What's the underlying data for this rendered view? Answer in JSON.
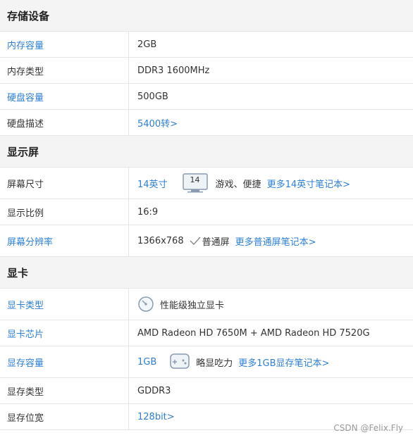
{
  "storage": {
    "title": "存储设备",
    "mem_capacity_label": "内存容量",
    "mem_capacity_value": "2GB",
    "mem_type_label": "内存类型",
    "mem_type_value": "DDR3 1600MHz",
    "disk_capacity_label": "硬盘容量",
    "disk_capacity_value": "500GB",
    "disk_desc_label": "硬盘描述",
    "disk_desc_value": "5400转>"
  },
  "display": {
    "title": "显示屏",
    "size_label": "屏幕尺寸",
    "size_value": "14英寸",
    "size_icon_number": "14",
    "size_note": "游戏、便捷",
    "size_more_link": "更多14英寸笔记本>",
    "ratio_label": "显示比例",
    "ratio_value": "16:9",
    "resolution_label": "屏幕分辨率",
    "resolution_value": "1366x768",
    "resolution_note": "普通屏",
    "resolution_more_link": "更多普通屏笔记本>"
  },
  "graphics": {
    "title": "显卡",
    "type_label": "显卡类型",
    "type_value": "性能级独立显卡",
    "chip_label": "显卡芯片",
    "chip_value": "AMD Radeon HD 7650M + AMD Radeon HD 7520G",
    "vram_capacity_label": "显存容量",
    "vram_capacity_value": "1GB",
    "vram_capacity_note": "略显吃力",
    "vram_capacity_more_link": "更多1GB显存笔记本>",
    "vram_type_label": "显存类型",
    "vram_type_value": "GDDR3",
    "vram_width_label": "显存位宽",
    "vram_width_value": "128bit>"
  },
  "watermark": "CSDN @Felix.Fly",
  "colors": {
    "link": "#2c7fd6",
    "section_bg": "#f4f4f4",
    "border": "#e6e6e6"
  }
}
